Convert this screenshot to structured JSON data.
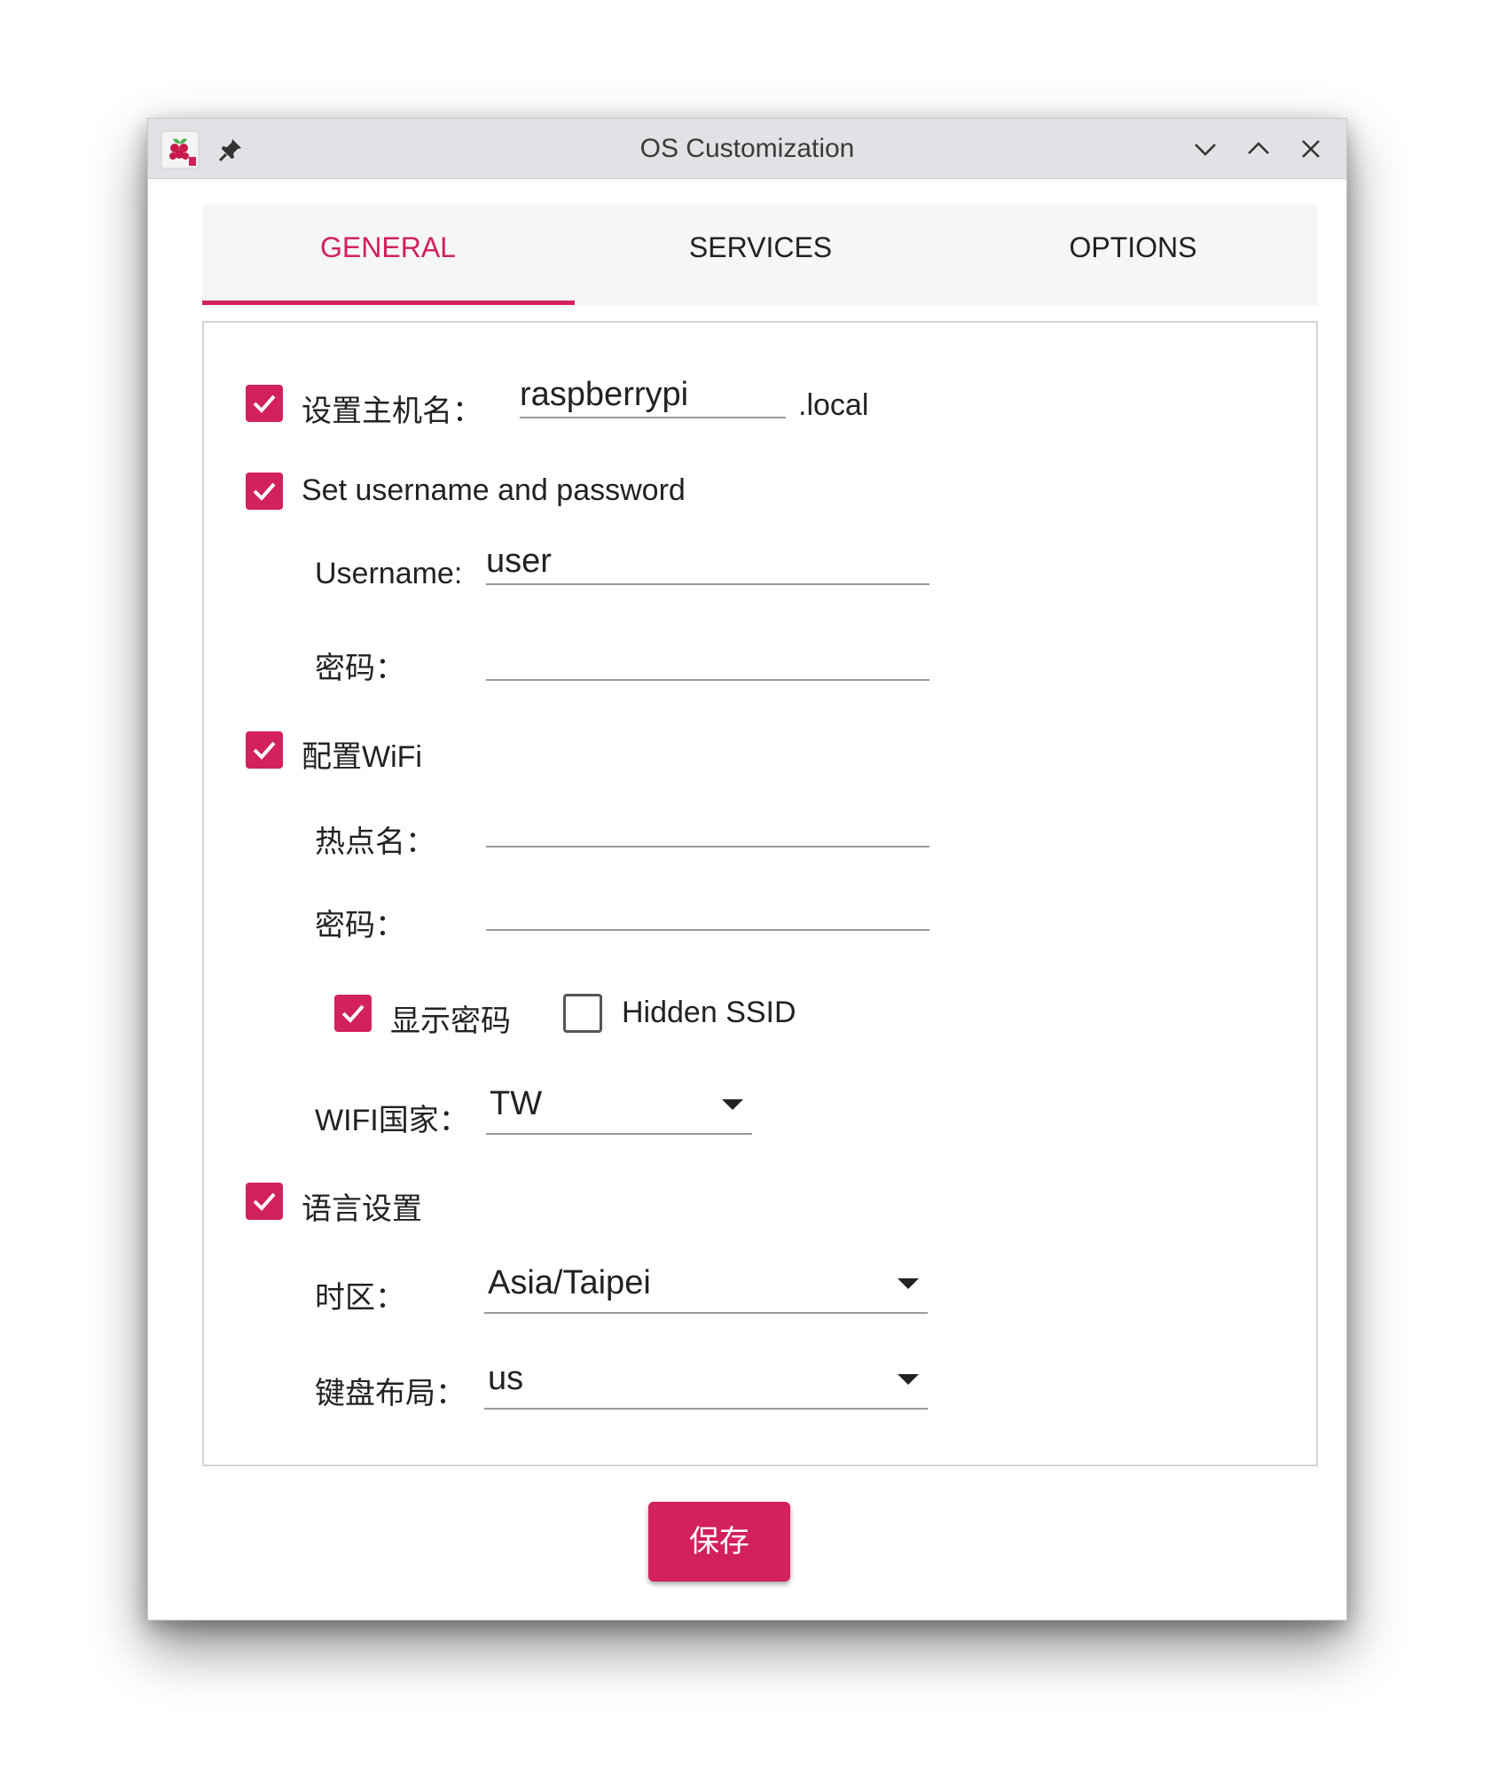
{
  "window": {
    "title": "OS Customization"
  },
  "tabs": [
    {
      "label": "GENERAL",
      "active": true
    },
    {
      "label": "SERVICES",
      "active": false
    },
    {
      "label": "OPTIONS",
      "active": false
    }
  ],
  "general": {
    "hostname": {
      "checked": true,
      "label": "设置主机名：",
      "value": "raspberrypi",
      "suffix": ".local"
    },
    "user": {
      "checked": true,
      "label": "Set username and password",
      "username_label": "Username:",
      "username_value": "user",
      "password_label": "密码：",
      "password_value": ""
    },
    "wifi": {
      "checked": true,
      "label": "配置WiFi",
      "ssid_label": "热点名：",
      "ssid_value": "",
      "password_label": "密码：",
      "password_value": "",
      "show_password": {
        "checked": true,
        "label": "显示密码"
      },
      "hidden_ssid": {
        "checked": false,
        "label": "Hidden SSID"
      },
      "country_label": "WIFI国家：",
      "country_value": "TW"
    },
    "locale": {
      "checked": true,
      "label": "语言设置",
      "timezone_label": "时区：",
      "timezone_value": "Asia/Taipei",
      "keyboard_label": "键盘布局：",
      "keyboard_value": "us"
    }
  },
  "save_label": "保存",
  "colors": {
    "accent": "#d2215c",
    "titlebar": "#e1e2e5"
  }
}
